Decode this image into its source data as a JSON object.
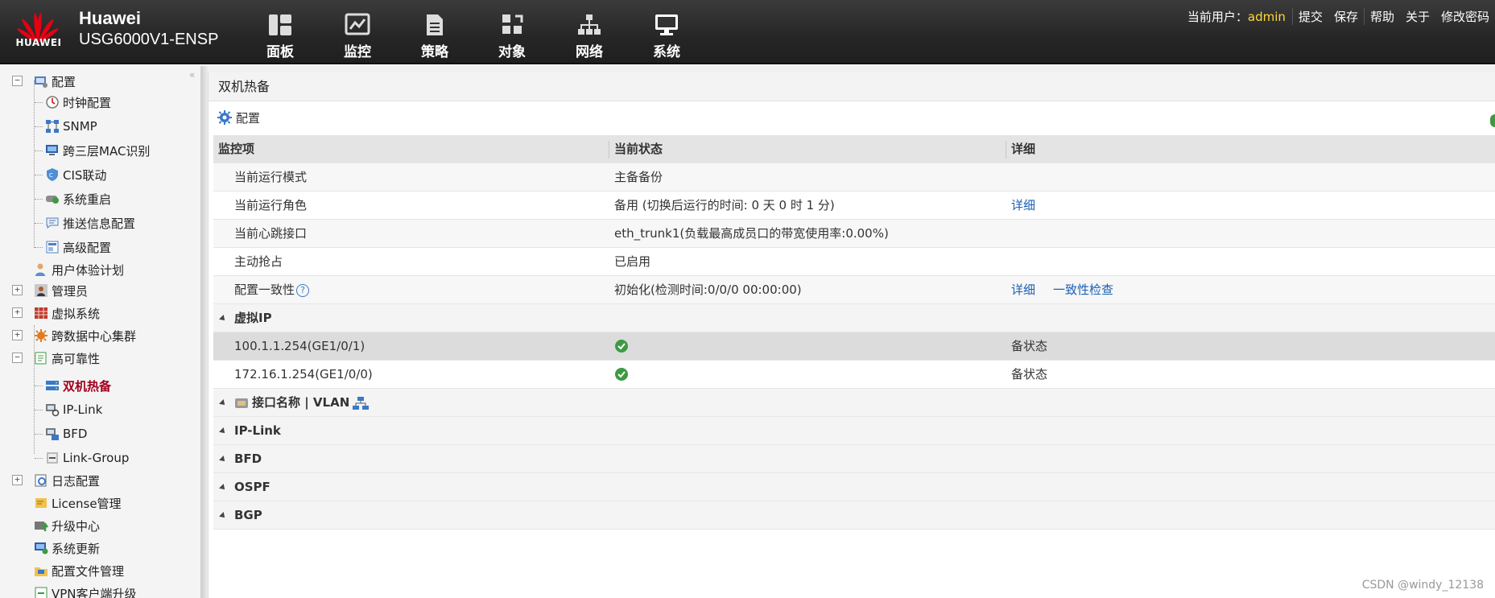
{
  "header": {
    "logo_text": "HUAWEI",
    "brand": "Huawei",
    "model": "USG6000V1-ENSP",
    "nav": [
      {
        "label": "面板",
        "icon": "dashboard-icon"
      },
      {
        "label": "监控",
        "icon": "monitor-chart-icon"
      },
      {
        "label": "策略",
        "icon": "policy-document-icon"
      },
      {
        "label": "对象",
        "icon": "object-icon"
      },
      {
        "label": "网络",
        "icon": "network-icon"
      },
      {
        "label": "系统",
        "icon": "system-display-icon"
      }
    ],
    "user_label": "当前用户：",
    "user_name": "admin",
    "links": [
      "提交",
      "保存",
      "帮助",
      "关于",
      "修改密码"
    ]
  },
  "sidebar": {
    "collapse": "«",
    "items": [
      {
        "label": "配置",
        "icon": "config-icon"
      },
      {
        "label": "时钟配置",
        "icon": "clock-icon"
      },
      {
        "label": "SNMP",
        "icon": "snmp-icon"
      },
      {
        "label": "跨三层MAC识别",
        "icon": "mac-identify-icon"
      },
      {
        "label": "CIS联动",
        "icon": "cis-link-icon"
      },
      {
        "label": "系统重启",
        "icon": "restart-icon"
      },
      {
        "label": "推送信息配置",
        "icon": "push-message-icon"
      },
      {
        "label": "高级配置",
        "icon": "advanced-config-icon"
      },
      {
        "label": "用户体验计划",
        "icon": "user-experience-icon"
      },
      {
        "label": "管理员",
        "icon": "admin-icon"
      },
      {
        "label": "虚拟系统",
        "icon": "virtual-system-icon"
      },
      {
        "label": "跨数据中心集群",
        "icon": "cluster-icon"
      },
      {
        "label": "高可靠性",
        "icon": "high-reliability-icon"
      },
      {
        "label": "双机热备",
        "icon": "hot-standby-icon"
      },
      {
        "label": "IP-Link",
        "icon": "ip-link-icon"
      },
      {
        "label": "BFD",
        "icon": "bfd-icon"
      },
      {
        "label": "Link-Group",
        "icon": "link-group-icon"
      },
      {
        "label": "日志配置",
        "icon": "log-config-icon"
      },
      {
        "label": "License管理",
        "icon": "license-icon"
      },
      {
        "label": "升级中心",
        "icon": "upgrade-center-icon"
      },
      {
        "label": "系统更新",
        "icon": "system-update-icon"
      },
      {
        "label": "配置文件管理",
        "icon": "config-file-icon"
      },
      {
        "label": "VPN客户端升级",
        "icon": "vpn-upgrade-icon"
      }
    ]
  },
  "main": {
    "title": "双机热备",
    "config_label": "配置",
    "columns": [
      "监控项",
      "当前状态",
      "详细"
    ],
    "rows": [
      {
        "item": "当前运行模式",
        "status": "主备备份",
        "detail": []
      },
      {
        "item": "当前运行角色",
        "status": "备用 (切换后运行的时间: 0 天 0 时 1 分)",
        "detail": [
          "详细"
        ]
      },
      {
        "item": "当前心跳接口",
        "status": "eth_trunk1(负载最高成员口的带宽使用率:0.00%)",
        "detail": []
      },
      {
        "item": "主动抢占",
        "status": "已启用",
        "detail": []
      },
      {
        "item": "配置一致性",
        "help": "?",
        "status": "初始化(检测时间:0/0/0 00:00:00)",
        "detail": [
          "详细",
          "一致性检查"
        ]
      }
    ],
    "groups": {
      "virtual_ip": "虚拟IP",
      "interface": "接口名称 | VLAN",
      "iplink": "IP-Link",
      "bfd": "BFD",
      "ospf": "OSPF",
      "bgp": "BGP"
    },
    "vip_rows": [
      {
        "ip": "100.1.1.254(GE1/0/1)",
        "state": "备状态"
      },
      {
        "ip": "172.16.1.254(GE1/0/0)",
        "state": "备状态"
      }
    ]
  },
  "watermark": "CSDN @windy_12138",
  "colors": {
    "accent": "#a1001e",
    "link": "#1a5fb4",
    "user": "#ffd83a",
    "ok": "#3d9a43"
  }
}
